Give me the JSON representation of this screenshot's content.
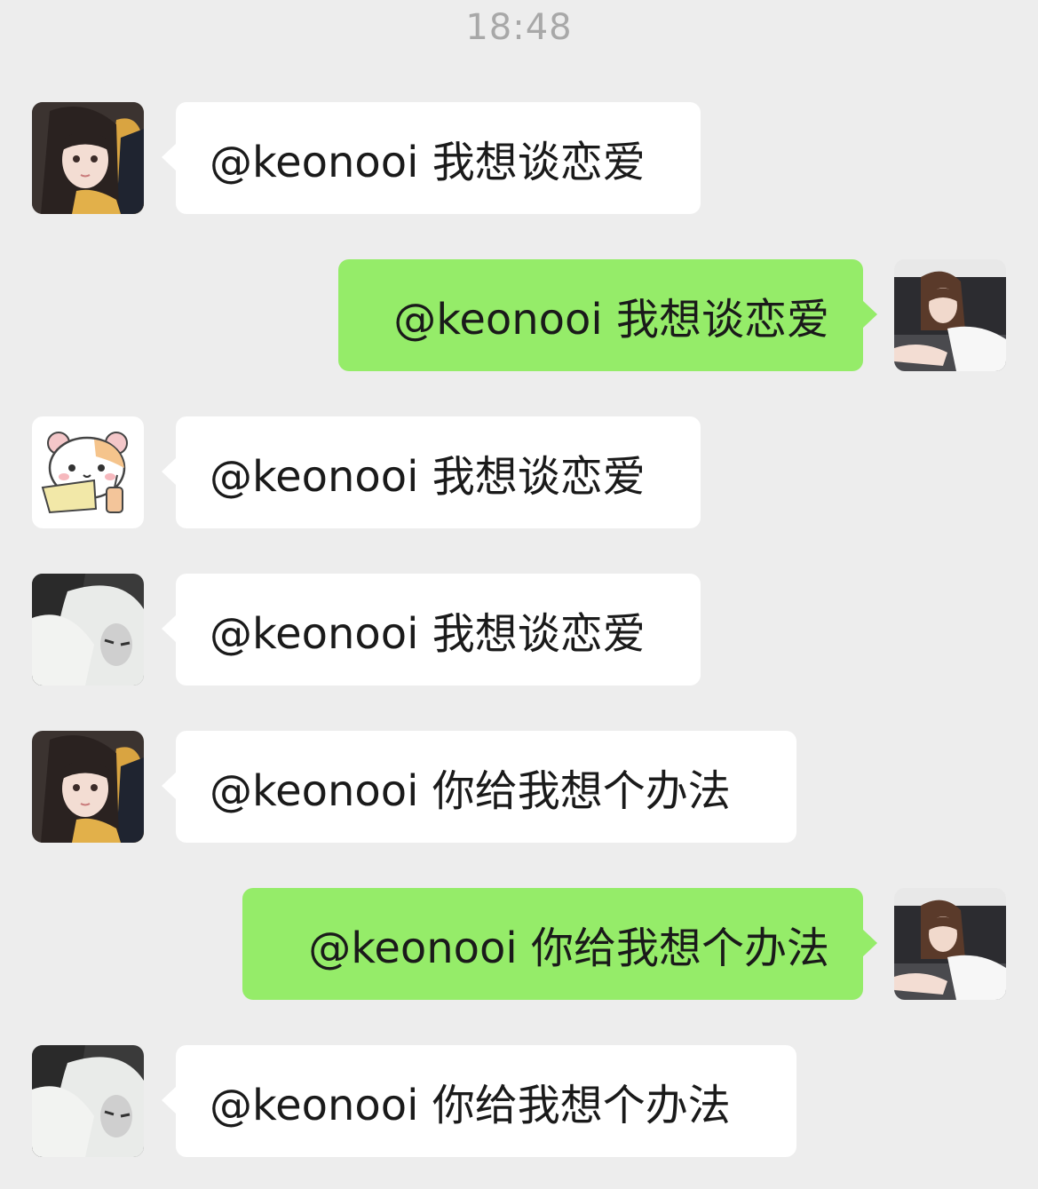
{
  "timestamp": "18:48",
  "messages": [
    {
      "side": "in",
      "text": "@keonooi 我想谈恋爱",
      "avatar": "avatar-girl-bangs"
    },
    {
      "side": "out",
      "text": "@keonooi 我想谈恋爱",
      "avatar": "avatar-girl-brown-hair"
    },
    {
      "side": "in",
      "text": "@keonooi 我想谈恋爱",
      "avatar": "avatar-hamster-cartoon"
    },
    {
      "side": "in",
      "text": "@keonooi 我想谈恋爱",
      "avatar": "avatar-white-hair"
    },
    {
      "side": "in",
      "text": "@keonooi 你给我想个办法",
      "avatar": "avatar-girl-bangs"
    },
    {
      "side": "out",
      "text": "@keonooi 你给我想个办法",
      "avatar": "avatar-girl-brown-hair"
    },
    {
      "side": "in",
      "text": "@keonooi 你给我想个办法",
      "avatar": "avatar-white-hair"
    }
  ],
  "colors": {
    "background": "#ededed",
    "incoming_bubble": "#ffffff",
    "outgoing_bubble": "#95ec69",
    "timestamp": "#a8a8a8"
  }
}
